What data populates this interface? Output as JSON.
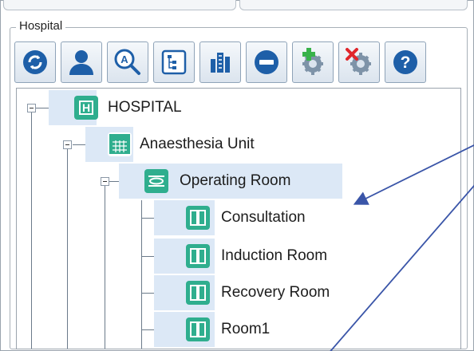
{
  "group": {
    "label": "Hospital"
  },
  "toolbar": {
    "buttons": [
      {
        "icon": "refresh-icon"
      },
      {
        "icon": "user-icon"
      },
      {
        "icon": "search-a-icon"
      },
      {
        "icon": "tree-structure-icon"
      },
      {
        "icon": "building-icon"
      },
      {
        "icon": "minus-circle-icon"
      },
      {
        "icon": "add-gear-icon"
      },
      {
        "icon": "remove-gear-icon"
      },
      {
        "icon": "help-icon"
      }
    ]
  },
  "tree": {
    "nodes": [
      {
        "label": "HOSPITAL",
        "icon": "hospital-icon",
        "level": 0
      },
      {
        "label": "Anaesthesia Unit",
        "icon": "calendar-unit-icon",
        "level": 1
      },
      {
        "label": "Operating Room",
        "icon": "operating-bed-icon",
        "level": 2
      },
      {
        "label": "Consultation",
        "icon": "room-door-icon",
        "level": 3
      },
      {
        "label": "Induction Room",
        "icon": "room-door-icon",
        "level": 3
      },
      {
        "label": "Recovery Room",
        "icon": "room-door-icon",
        "level": 3
      },
      {
        "label": "Room1",
        "icon": "room-door-icon",
        "level": 3
      }
    ]
  },
  "colors": {
    "accent_teal": "#2fae8e",
    "selection": "#dce8f6",
    "button_blue": "#1e5fa8",
    "arrow": "#3a55a8"
  }
}
